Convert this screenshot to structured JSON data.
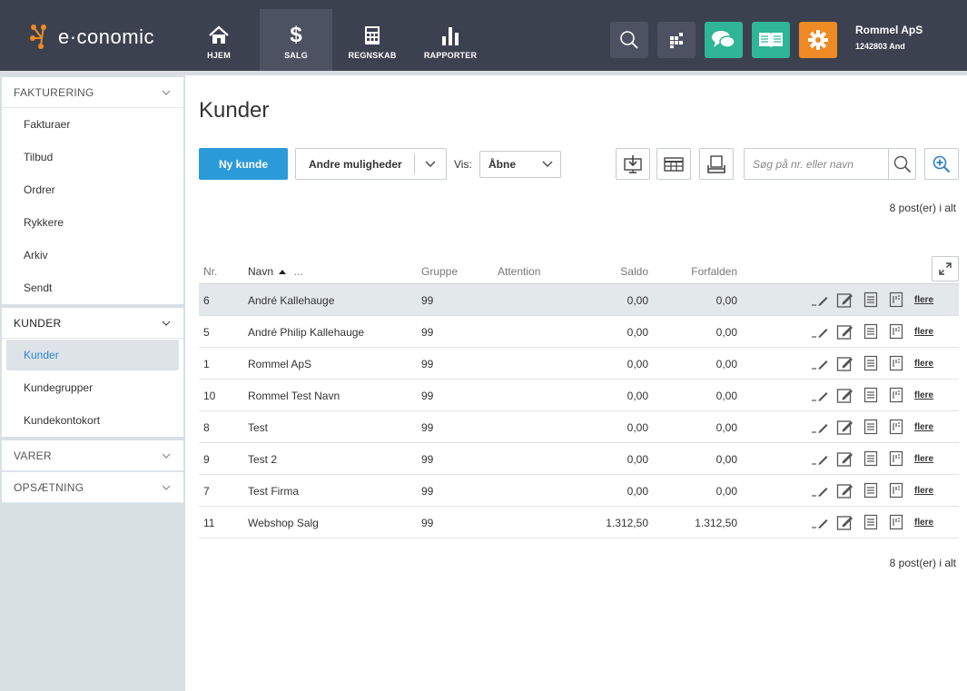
{
  "app": {
    "logo_text": "e·conomic",
    "company_name": "Rommel ApS",
    "company_id": "1242803 And"
  },
  "nav": [
    {
      "label": "HJEM",
      "icon": "home-icon"
    },
    {
      "label": "SALG",
      "icon": "dollar-icon"
    },
    {
      "label": "REGNSKAB",
      "icon": "calculator-icon"
    },
    {
      "label": "RAPPORTER",
      "icon": "bar-chart-icon"
    }
  ],
  "toolbar_icons": [
    {
      "icon": "search-icon",
      "color": "#4d5262"
    },
    {
      "icon": "apps-icon",
      "color": "#4d5262"
    },
    {
      "icon": "chat-icon",
      "color": "#2fb597"
    },
    {
      "icon": "book-icon",
      "color": "#2fb597"
    },
    {
      "icon": "gear-icon",
      "color": "#f08a24"
    }
  ],
  "sidebar": {
    "sections": [
      {
        "title": "FAKTURERING",
        "expanded": true,
        "items": [
          "Fakturaer",
          "Tilbud",
          "Ordrer",
          "Rykkere",
          "Arkiv",
          "Sendt"
        ]
      },
      {
        "title": "KUNDER",
        "expanded": true,
        "items": [
          "Kunder",
          "Kundegrupper",
          "Kundekontokort"
        ],
        "active_item": "Kunder"
      },
      {
        "title": "VARER",
        "expanded": false,
        "items": []
      },
      {
        "title": "OPSÆTNING",
        "expanded": false,
        "items": []
      }
    ]
  },
  "main": {
    "title": "Kunder",
    "new_button": "Ny kunde",
    "more_button": "Andre muligheder",
    "vis_label": "Vis:",
    "vis_value": "Åbne",
    "search_placeholder": "Søg på nr. eller navn",
    "count_top": "8 post(er) i alt",
    "count_bottom": "8 post(er) i alt"
  },
  "table": {
    "columns": {
      "nr": "Nr.",
      "navn": "Navn",
      "navn_more": "...",
      "gruppe": "Gruppe",
      "attention": "Attention",
      "saldo": "Saldo",
      "forfalden": "Forfalden"
    },
    "more_label": "flere",
    "rows": [
      {
        "nr": "6",
        "navn": "André Kallehauge",
        "gruppe": "99",
        "attention": "",
        "saldo": "0,00",
        "forfalden": "0,00"
      },
      {
        "nr": "5",
        "navn": "André Philip Kallehauge",
        "gruppe": "99",
        "attention": "",
        "saldo": "0,00",
        "forfalden": "0,00"
      },
      {
        "nr": "1",
        "navn": "Rommel ApS",
        "gruppe": "99",
        "attention": "",
        "saldo": "0,00",
        "forfalden": "0,00"
      },
      {
        "nr": "10",
        "navn": "Rommel Test Navn",
        "gruppe": "99",
        "attention": "",
        "saldo": "0,00",
        "forfalden": "0,00"
      },
      {
        "nr": "8",
        "navn": "Test",
        "gruppe": "99",
        "attention": "",
        "saldo": "0,00",
        "forfalden": "0,00"
      },
      {
        "nr": "9",
        "navn": "Test 2",
        "gruppe": "99",
        "attention": "",
        "saldo": "0,00",
        "forfalden": "0,00"
      },
      {
        "nr": "7",
        "navn": "Test Firma",
        "gruppe": "99",
        "attention": "",
        "saldo": "0,00",
        "forfalden": "0,00"
      },
      {
        "nr": "11",
        "navn": "Webshop Salg",
        "gruppe": "99",
        "attention": "",
        "saldo": "1.312,50",
        "forfalden": "1.312,50"
      }
    ]
  }
}
